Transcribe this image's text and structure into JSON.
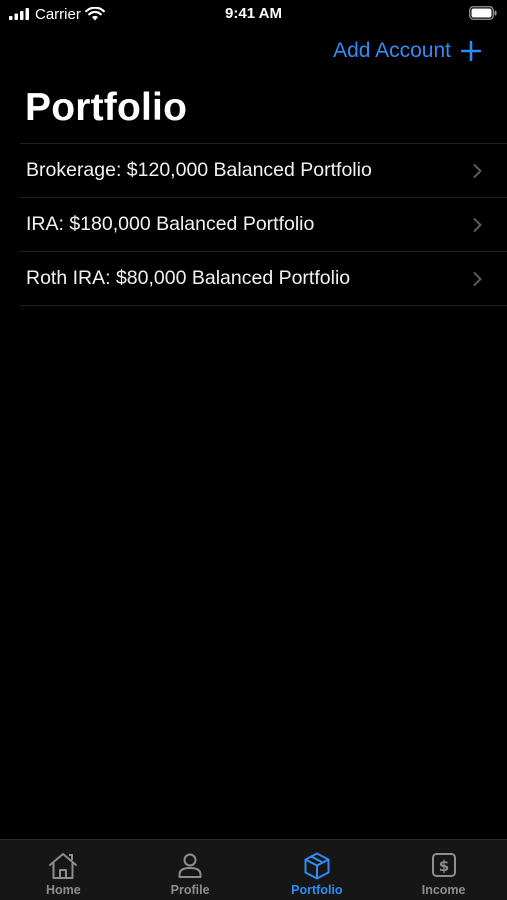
{
  "status_bar": {
    "carrier": "Carrier",
    "time": "9:41 AM",
    "icons": [
      "signal-icon",
      "wifi-icon",
      "battery-icon"
    ]
  },
  "nav": {
    "add_account_label": "Add Account",
    "add_icon": "plus-icon"
  },
  "page": {
    "title": "Portfolio"
  },
  "accounts": [
    {
      "label": "Brokerage: $120,000 Balanced Portfolio"
    },
    {
      "label": "IRA: $180,000 Balanced Portfolio"
    },
    {
      "label": "Roth IRA: $80,000 Balanced Portfolio"
    }
  ],
  "tab_bar": {
    "active": "Portfolio",
    "tabs": [
      {
        "label": "Home",
        "icon": "home-icon"
      },
      {
        "label": "Profile",
        "icon": "person-icon"
      },
      {
        "label": "Portfolio",
        "icon": "cube-icon"
      },
      {
        "label": "Income",
        "icon": "dollar-icon"
      }
    ]
  },
  "colors": {
    "background": "#000000",
    "accent": "#2f8cf6",
    "tab_inactive": "#8e8e8e",
    "tab_bar_bg": "#161616"
  }
}
